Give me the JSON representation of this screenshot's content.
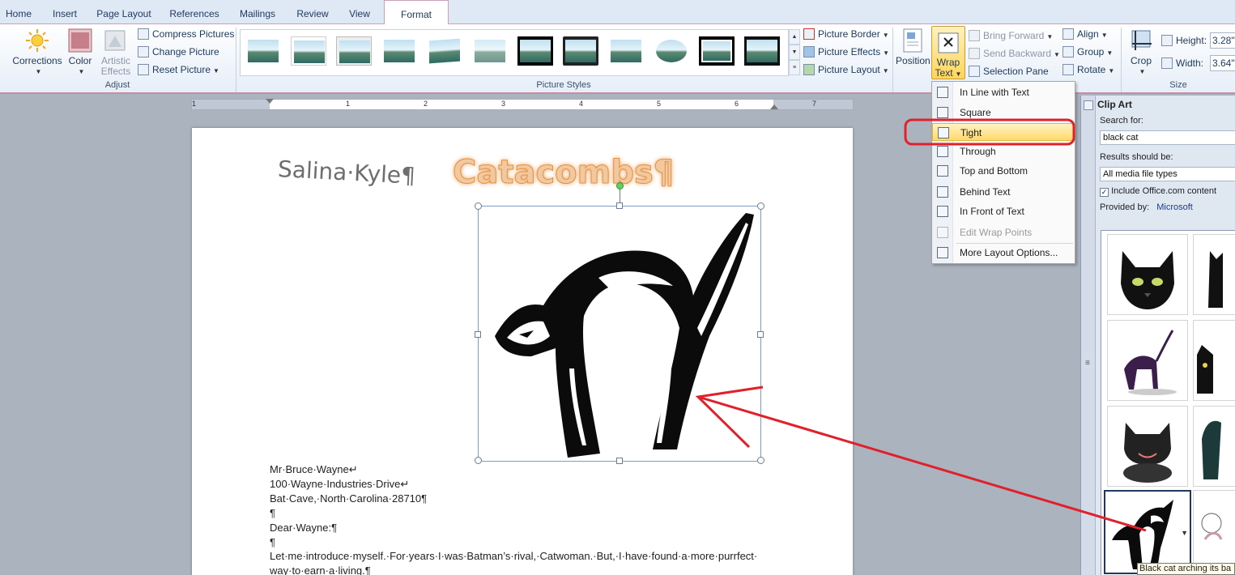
{
  "tabs": [
    {
      "label": "Home"
    },
    {
      "label": "Insert"
    },
    {
      "label": "Page Layout"
    },
    {
      "label": "References"
    },
    {
      "label": "Mailings"
    },
    {
      "label": "Review"
    },
    {
      "label": "View"
    },
    {
      "label": "Format",
      "active": true
    }
  ],
  "ribbon": {
    "adjust": {
      "label": "Adjust",
      "corrections": "Corrections",
      "color": "Color",
      "artistic_effects": "Artistic Effects",
      "compress_pictures": "Compress Pictures",
      "change_picture": "Change Picture",
      "reset_picture": "Reset Picture"
    },
    "picture_styles": {
      "label": "Picture Styles",
      "picture_border": "Picture Border",
      "picture_effects": "Picture Effects",
      "picture_layout": "Picture Layout"
    },
    "arrange": {
      "position": "Position",
      "wrap_text_line1": "Wrap",
      "wrap_text_line2": "Text",
      "bring_forward": "Bring Forward",
      "send_backward": "Send Backward",
      "selection_pane": "Selection Pane",
      "align": "Align",
      "group": "Group",
      "rotate": "Rotate"
    },
    "size": {
      "label": "Size",
      "crop": "Crop",
      "height_label": "Height:",
      "height_value": "3.28\"",
      "width_label": "Width:",
      "width_value": "3.64\""
    }
  },
  "ruler": {
    "numbers": [
      "1",
      "1",
      "2",
      "3",
      "4",
      "5",
      "6",
      "7"
    ]
  },
  "document": {
    "heading_left": "Salina·Kyle¶",
    "heading_wordart": "Catacombs¶",
    "lines": [
      "Mr·Bruce·Wayne↵",
      "100·Wayne·Industries·Drive↵",
      "Bat·Cave,·North·Carolina·28710¶",
      "¶",
      "Dear·Wayne:¶",
      "¶",
      "Let·me·introduce·myself.·For·years·I·was·Batman’s·rival,·Catwoman.·But,·I·have·found·a·more·purrfect·",
      "way·to·earn·a·living.¶"
    ]
  },
  "wrap_menu": {
    "items": [
      {
        "label": "In Line with Text",
        "icon": "inline-wrap-icon"
      },
      {
        "label": "Square",
        "icon": "square-wrap-icon"
      },
      {
        "label": "Tight",
        "icon": "tight-wrap-icon",
        "highlighted": true
      },
      {
        "label": "Through",
        "icon": "through-wrap-icon"
      },
      {
        "label": "Top and Bottom",
        "icon": "top-bottom-wrap-icon"
      },
      {
        "label": "Behind Text",
        "icon": "behind-text-icon"
      },
      {
        "label": "In Front of Text",
        "icon": "in-front-text-icon"
      },
      {
        "label": "Edit Wrap Points",
        "icon": "edit-wrap-points-icon",
        "disabled": true
      },
      {
        "label": "More Layout Options...",
        "icon": "layout-options-icon"
      }
    ]
  },
  "clip_art": {
    "title": "Clip Art",
    "search_label": "Search for:",
    "search_value": "black cat",
    "results_label": "Results should be:",
    "results_value": "All media file types",
    "include_office": "Include Office.com content",
    "provided_by_label": "Provided by:",
    "provided_by_value": "Microsoft",
    "tooltip": "Black cat arching its ba"
  },
  "colors": {
    "accent_pink": "#c98aa5",
    "highlight_yellow": "#ffd96b",
    "annotation_red": "#e0202a",
    "wordart_orange": "#e8913f"
  }
}
